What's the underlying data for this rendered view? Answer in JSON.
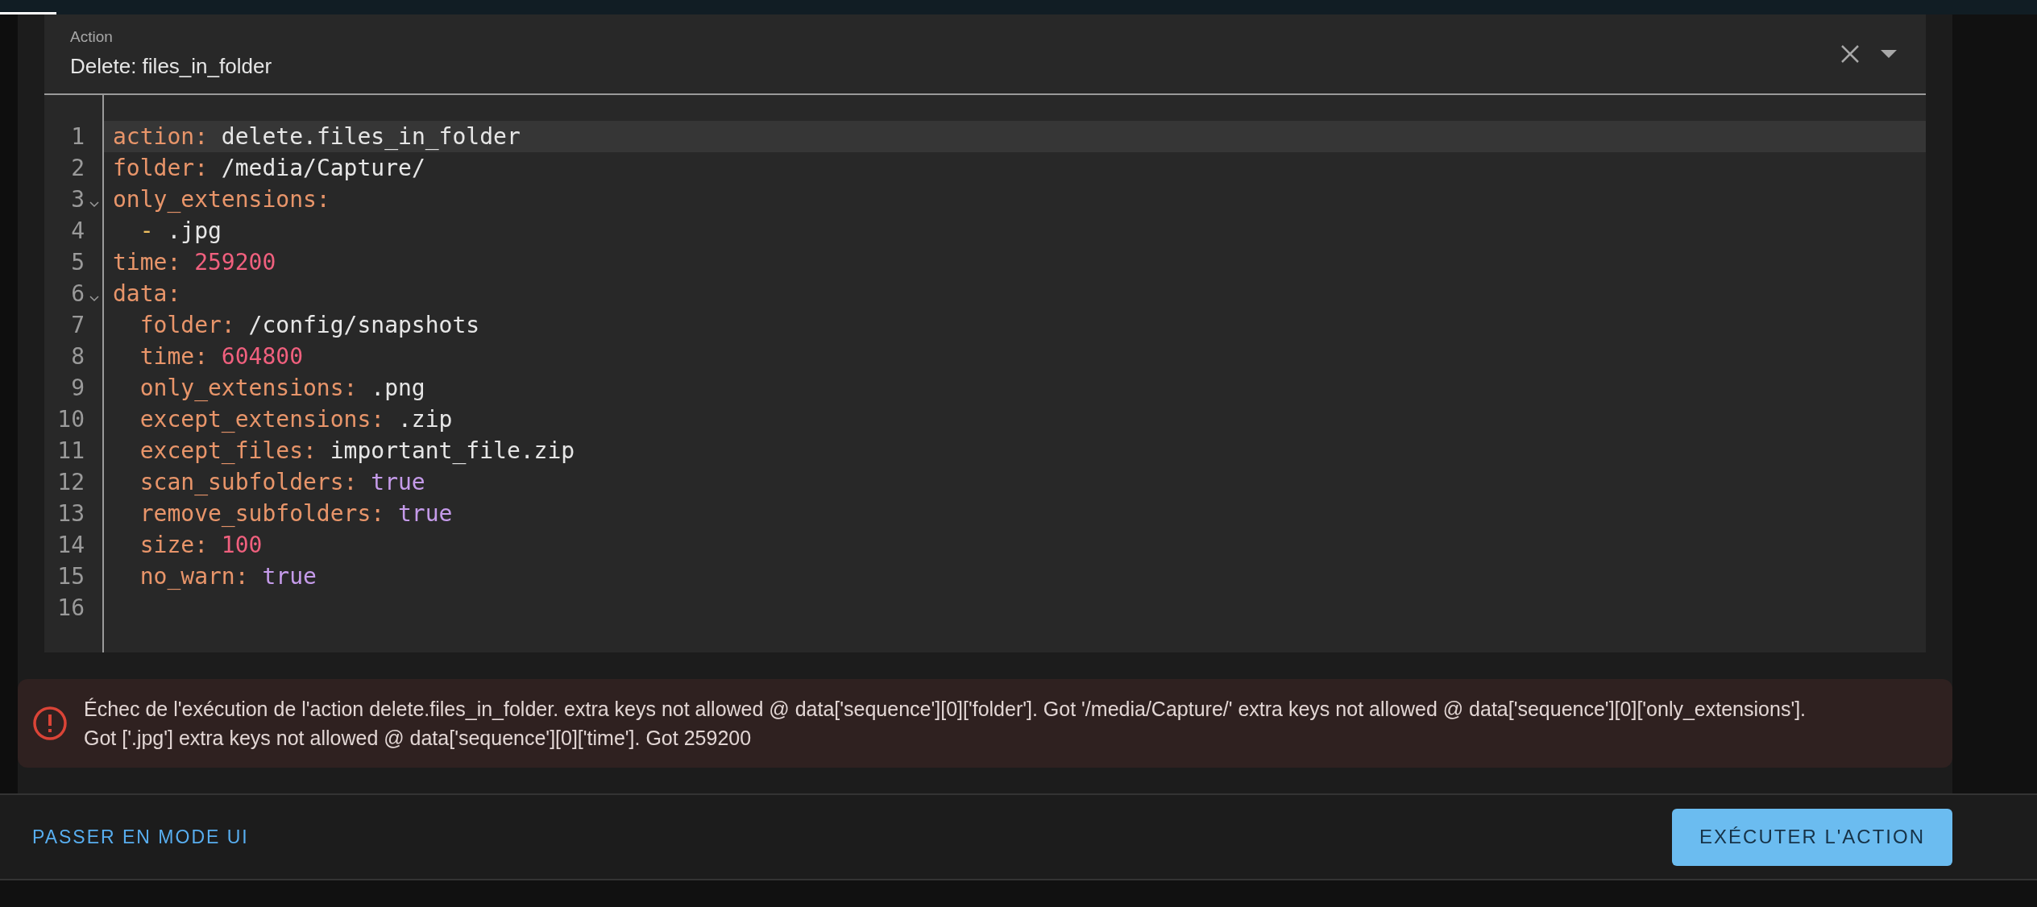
{
  "header": {
    "label": "Action",
    "title": "Delete: files_in_folder"
  },
  "editor": {
    "lines": [
      {
        "number": "1",
        "active": true,
        "foldable": false,
        "tokens": [
          {
            "kind": "key",
            "text": "action:"
          },
          {
            "kind": "string",
            "text": " delete.files_in_folder"
          }
        ]
      },
      {
        "number": "2",
        "active": false,
        "foldable": false,
        "tokens": [
          {
            "kind": "key",
            "text": "folder:"
          },
          {
            "kind": "string",
            "text": " /media/Capture/"
          }
        ]
      },
      {
        "number": "3",
        "active": false,
        "foldable": true,
        "tokens": [
          {
            "kind": "key",
            "text": "only_extensions:"
          }
        ]
      },
      {
        "number": "4",
        "active": false,
        "foldable": false,
        "tokens": [
          {
            "kind": "dash",
            "text": "  - "
          },
          {
            "kind": "string",
            "text": ".jpg"
          }
        ]
      },
      {
        "number": "5",
        "active": false,
        "foldable": false,
        "tokens": [
          {
            "kind": "key",
            "text": "time:"
          },
          {
            "kind": "number",
            "text": " 259200"
          }
        ]
      },
      {
        "number": "6",
        "active": false,
        "foldable": true,
        "tokens": [
          {
            "kind": "key",
            "text": "data:"
          }
        ]
      },
      {
        "number": "7",
        "active": false,
        "foldable": false,
        "tokens": [
          {
            "kind": "key",
            "text": "  folder:"
          },
          {
            "kind": "string",
            "text": " /config/snapshots"
          }
        ]
      },
      {
        "number": "8",
        "active": false,
        "foldable": false,
        "tokens": [
          {
            "kind": "key",
            "text": "  time:"
          },
          {
            "kind": "number",
            "text": " 604800"
          }
        ]
      },
      {
        "number": "9",
        "active": false,
        "foldable": false,
        "tokens": [
          {
            "kind": "key",
            "text": "  only_extensions:"
          },
          {
            "kind": "string",
            "text": " .png"
          }
        ]
      },
      {
        "number": "10",
        "active": false,
        "foldable": false,
        "tokens": [
          {
            "kind": "key",
            "text": "  except_extensions:"
          },
          {
            "kind": "string",
            "text": " .zip"
          }
        ]
      },
      {
        "number": "11",
        "active": false,
        "foldable": false,
        "tokens": [
          {
            "kind": "key",
            "text": "  except_files:"
          },
          {
            "kind": "string",
            "text": " important_file.zip"
          }
        ]
      },
      {
        "number": "12",
        "active": false,
        "foldable": false,
        "tokens": [
          {
            "kind": "key",
            "text": "  scan_subfolders:"
          },
          {
            "kind": "bool",
            "text": " true"
          }
        ]
      },
      {
        "number": "13",
        "active": false,
        "foldable": false,
        "tokens": [
          {
            "kind": "key",
            "text": "  remove_subfolders:"
          },
          {
            "kind": "bool",
            "text": " true"
          }
        ]
      },
      {
        "number": "14",
        "active": false,
        "foldable": false,
        "tokens": [
          {
            "kind": "key",
            "text": "  size:"
          },
          {
            "kind": "number",
            "text": " 100"
          }
        ]
      },
      {
        "number": "15",
        "active": false,
        "foldable": false,
        "tokens": [
          {
            "kind": "key",
            "text": "  no_warn:"
          },
          {
            "kind": "bool",
            "text": " true"
          }
        ]
      },
      {
        "number": "16",
        "active": false,
        "foldable": false
      }
    ]
  },
  "error": {
    "message": "Échec de l'exécution de l'action delete.files_in_folder. extra keys not allowed @ data['sequence'][0]['folder']. Got '/media/Capture/' extra keys not allowed @ data['sequence'][0]['only_extensions']. Got ['.jpg'] extra keys not allowed @ data['sequence'][0]['time']. Got 259200"
  },
  "footer": {
    "switch_link": "PASSER EN MODE UI",
    "run_button": "EXÉCUTER L'ACTION"
  }
}
